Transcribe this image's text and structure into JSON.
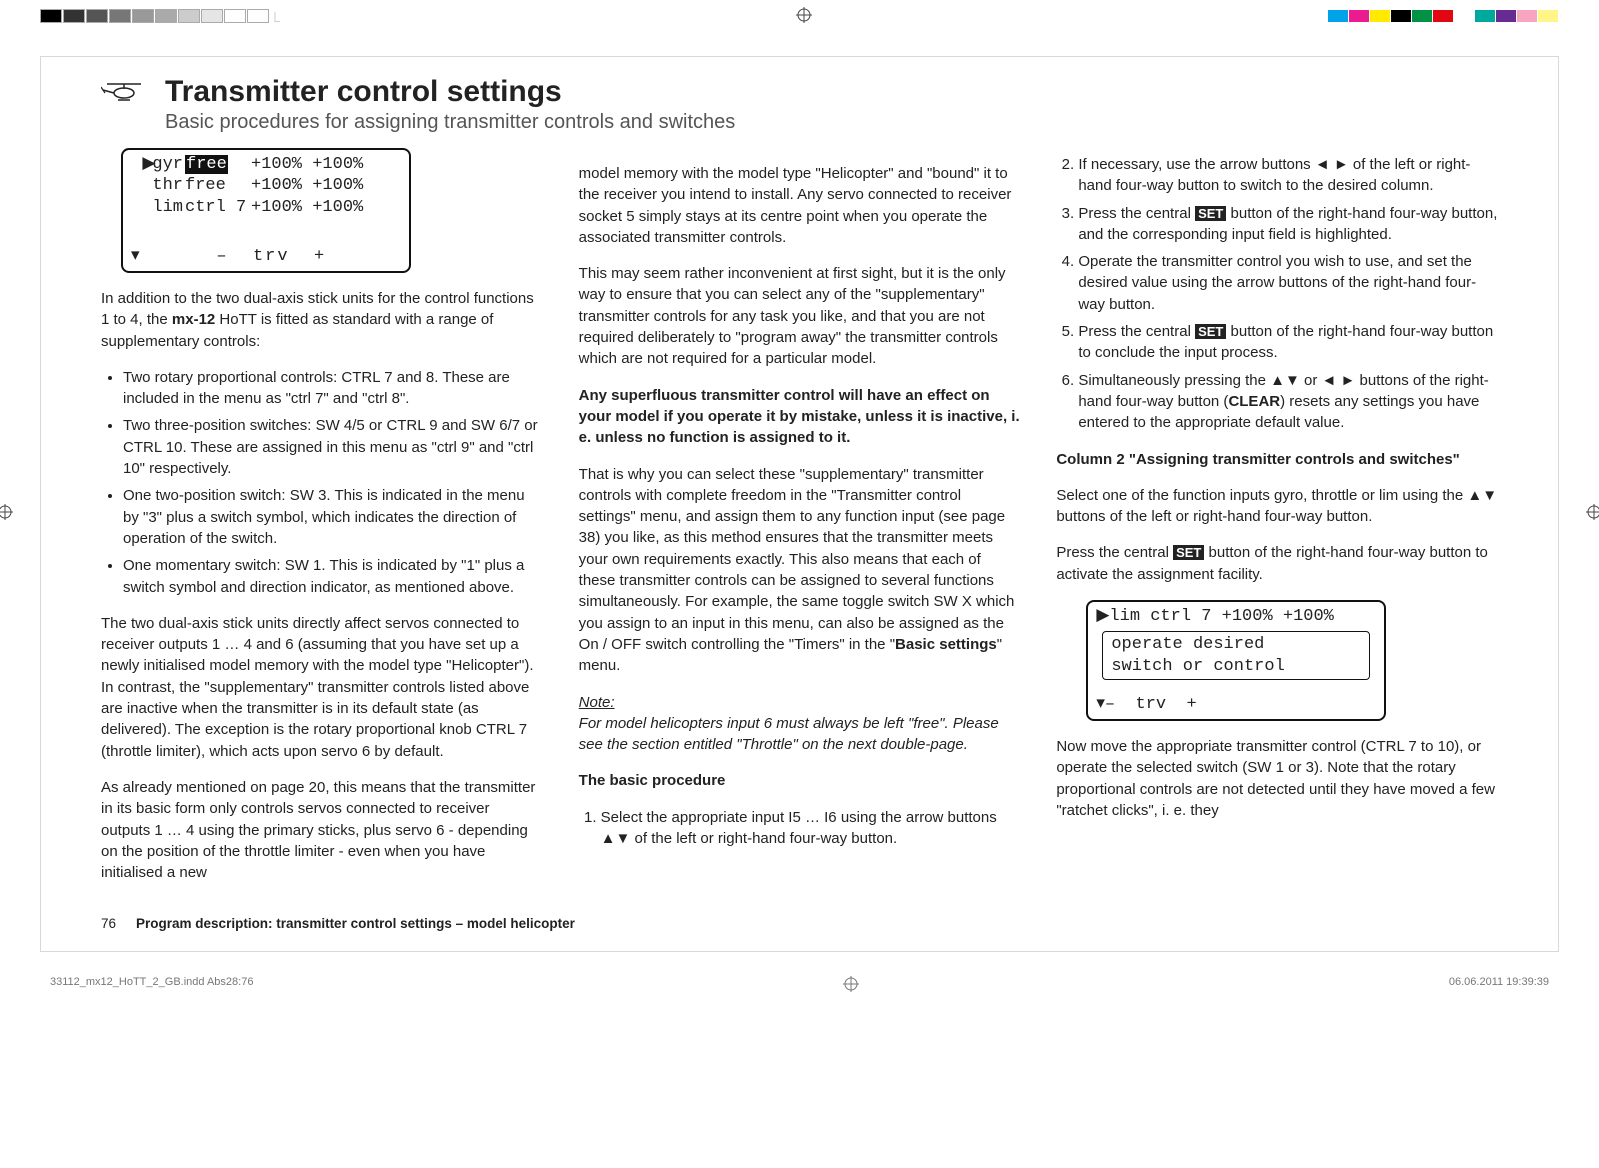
{
  "header": {
    "title": "Transmitter control settings",
    "subtitle": "Basic procedures for assigning transmitter controls and switches"
  },
  "lcd1": {
    "r1_lbl": "gyr",
    "r1_v1": "free",
    "r1_v2": "+100% +100%",
    "r2_lbl": "thr",
    "r2_v1": "free",
    "r2_v2": "+100% +100%",
    "r3_lbl": "lim",
    "r3_v1": "ctrl  7",
    "r3_v2": "+100% +100%",
    "footer_minus": "–",
    "footer_trv": "trv",
    "footer_plus": "+"
  },
  "col1": {
    "intro_a": "In addition to the two dual-axis stick units for the control functions 1 to 4, the ",
    "intro_model": "mx-12",
    "intro_b": " HoTT is fitted as standard with a range of supplementary controls:",
    "b1": "Two rotary proportional controls: CTRL 7 and 8. These are included in the menu as \"ctrl 7\" and \"ctrl 8\".",
    "b2": "Two three-position switches: SW 4/5 or CTRL 9 and SW 6/7 or CTRL 10. These are assigned in this menu as \"ctrl 9\" and \"ctrl 10\" respectively.",
    "b3": "One two-position switch: SW 3. This is indicated in the menu by \"3\" plus a switch symbol, which indicates the direction of operation of the switch.",
    "b4": "One momentary switch: SW 1. This is indicated by \"1\" plus a switch symbol and direction indicator, as mentioned above.",
    "p2": "The two dual-axis stick units directly affect servos connected to receiver outputs 1 … 4 and 6 (assuming that you have set up a newly initialised model memory with the model type \"Helicopter\"). In contrast, the \"supplementary\" transmitter controls listed above are inactive when the transmitter is in its default state (as delivered). The exception is the rotary proportional knob CTRL 7 (throttle limiter), which acts upon servo 6 by default.",
    "p3": "As already mentioned on page 20, this means that the transmitter in its basic form only controls servos connected to receiver outputs 1 … 4 using the primary sticks, plus servo 6 - depending on the position of the throttle limiter - even when you have initialised a new"
  },
  "col2": {
    "p1": "model memory with the model type \"Helicopter\" and \"bound\" it to the receiver you intend to install. Any servo connected to receiver socket 5 simply stays at its centre point when you operate the associated transmitter controls.",
    "p2": "This may seem rather inconvenient at first sight, but it is the only way to ensure that you can select any of the \"supplementary\" transmitter controls for any task you like, and that you are not required deliberately to \"program away\" the transmitter controls which are not required for a particular model.",
    "p3": "Any superfluous transmitter control will have an effect on your model if you operate it by mistake, unless it is inactive, i. e. unless no function is assigned to it.",
    "p4a": "That is why you can select these \"supplementary\" transmitter controls with complete freedom in the \"Transmitter control settings\" menu, and assign them to any function input (see page 38) you like, as this method ensures that the transmitter meets your own requirements exactly. This also means that each of these transmitter controls can be assigned to several functions simultaneously. For example, the same toggle switch SW X which you assign to an input in this menu, can also be assigned as the On / OFF switch controlling the \"Timers\" in the \"",
    "p4b": "Basic settings",
    "p4c": "\" menu.",
    "note_lbl": "Note:",
    "note_txt": "For model helicopters input 6 must always be left \"free\". Please see the section entitled \"Throttle\" on the next double-page.",
    "proc_heading": "The basic procedure",
    "step1": "Select the appropriate input I5 … I6 using the arrow buttons ▲▼ of the left or right-hand four-way button."
  },
  "col3": {
    "step2": "If necessary, use the arrow buttons ◄ ► of the left or right-hand four-way button to switch to the desired column.",
    "step3a": "Press the central ",
    "step3b": " button of the right-hand four-way button, and the corresponding input field is highlighted.",
    "step4": "Operate the transmitter control you wish to use, and set the desired value using the arrow buttons of the right-hand four-way button.",
    "step5a": "Press the central ",
    "step5b": " button of the right-hand four-way button to conclude the input process.",
    "step6a": "Simultaneously pressing the ▲▼ or ◄ ► buttons of the right-hand four-way button (",
    "step6b": "CLEAR",
    "step6c": ") resets any settings you have entered to the appropriate default value.",
    "col2head": "Column 2 \"Assigning transmitter controls and switches\"",
    "p_sel": "Select one of the function inputs gyro, throttle or lim using the ▲▼ buttons of the left or right-hand four-way button.",
    "p_press_a": "Press the central ",
    "p_press_b": " button of the right-hand four-way button to activate the assignment facility.",
    "set_label": "SET",
    "p_after": "Now move the appropriate transmitter control (CTRL 7 to 10), or operate the selected switch (SW 1 or 3). Note that the rotary proportional controls are not detected until they have moved a few \"ratchet clicks\", i. e. they"
  },
  "lcd2": {
    "r1_lbl": "lim",
    "r1_v1": "ctrl  7",
    "r1_v2": "+100% +100%",
    "msg1": "operate desired",
    "msg2": "switch  or  control",
    "footer_minus": "–",
    "footer_trv": "trv",
    "footer_plus": "+"
  },
  "footer": {
    "pgnum": "76",
    "running": "Program description: transmitter control settings – model helicopter",
    "doc_left": "33112_mx12_HoTT_2_GB.indd   Abs28:76",
    "doc_right": "06.06.2011   19:39:39"
  },
  "color_swatches_left": [
    "#000",
    "#333",
    "#555",
    "#777",
    "#999",
    "#aaa",
    "#ccc",
    "#e5e5e5",
    "#fff",
    "#fff"
  ],
  "color_swatches_right": [
    "#00a3e8",
    "#ed1b90",
    "#ffea00",
    "#000",
    "#009245",
    "#e30613",
    "#fff",
    "#00a99d",
    "#662c91",
    "#f7a5c1",
    "#fff685"
  ]
}
